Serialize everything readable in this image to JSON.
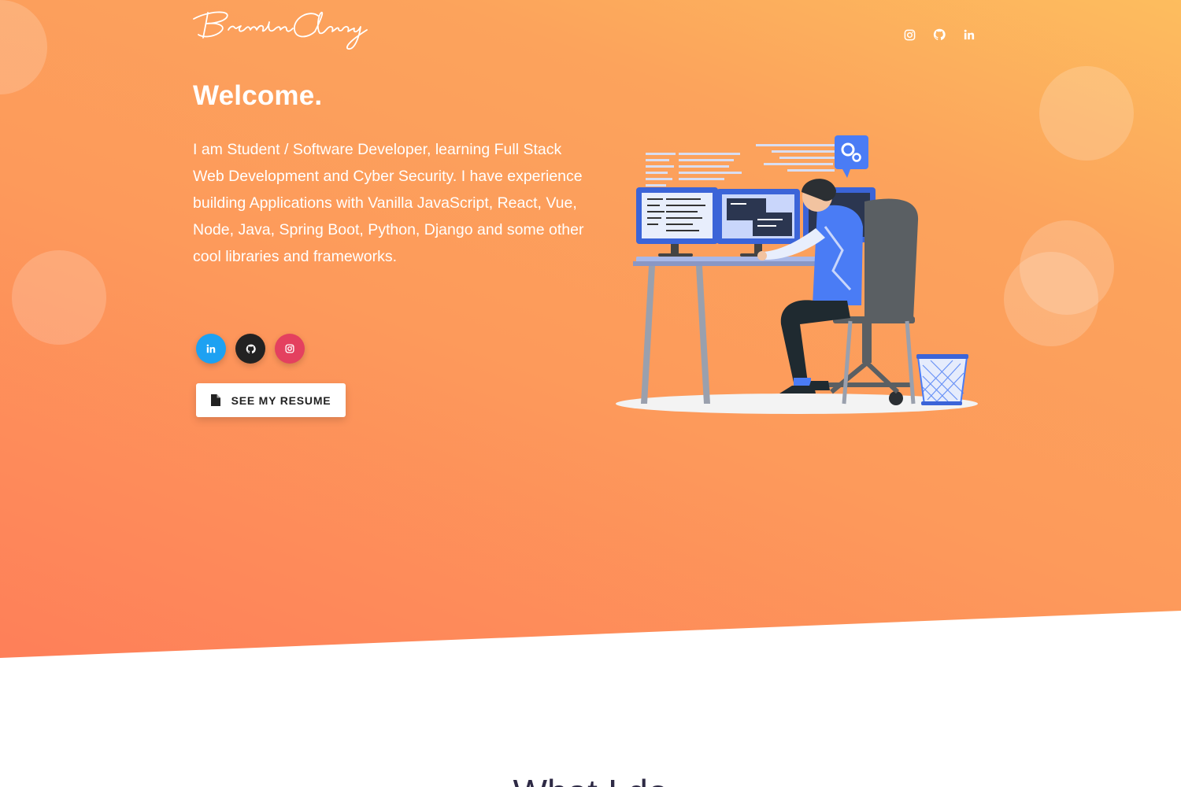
{
  "brand": {
    "logo_text": "Brendan Clancy"
  },
  "nav": {
    "icons": [
      "instagram-icon",
      "github-icon",
      "linkedin-icon"
    ]
  },
  "hero": {
    "title": "Welcome.",
    "intro": "I am Student / Software Developer, learning Full Stack Web Development and Cyber Security. I have experience building Applications with Vanilla JavaScript, React, Vue, Node, Java, Spring Boot, Python, Django and some other cool libraries and frameworks.",
    "social": [
      {
        "icon": "linkedin-icon",
        "color": "#1da1f2"
      },
      {
        "icon": "github-icon",
        "color": "#222222"
      },
      {
        "icon": "instagram-icon",
        "color": "#e4405f"
      }
    ],
    "resume_label": "SEE MY RESUME"
  },
  "next_section": {
    "heading": "What I do"
  },
  "colors": {
    "gradient_top": "#fdbd5e",
    "gradient_bottom": "#fe7f59",
    "text_on_gradient": "#ffffff",
    "heading_dark": "#2e2a45"
  }
}
